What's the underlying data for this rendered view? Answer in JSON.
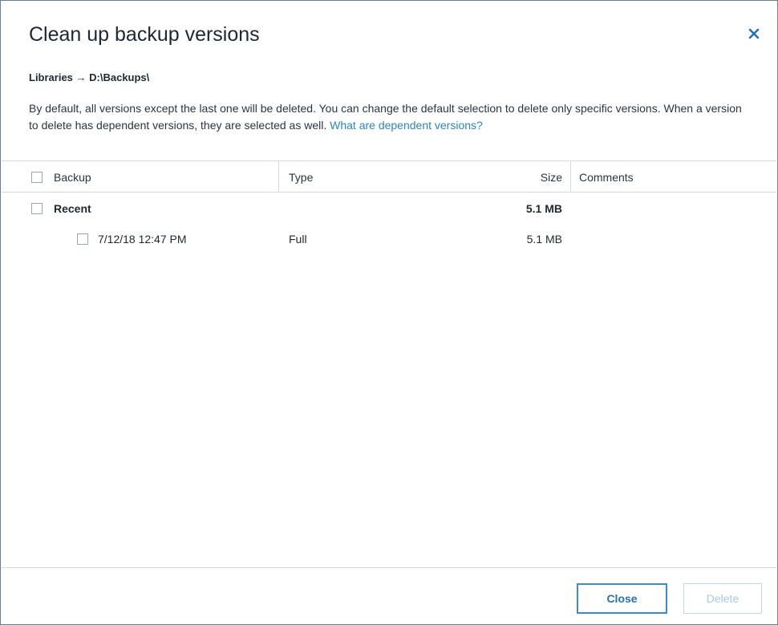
{
  "dialog": {
    "title": "Clean up backup versions",
    "breadcrumb": "Libraries → D:\\Backups\\",
    "description": "By default, all versions except the last one will be deleted. You can change the default selection to delete only specific versions. When a version to delete has dependent versions, they are selected as well.",
    "help_link": "What are dependent versions?",
    "close_icon": "close-icon"
  },
  "table": {
    "columns": {
      "backup": "Backup",
      "type": "Type",
      "size": "Size",
      "comments": "Comments"
    },
    "groups": [
      {
        "name": "Recent",
        "size": "5.1 MB",
        "versions": [
          {
            "date": "7/12/18 12:47 PM",
            "type": "Full",
            "size": "5.1 MB",
            "comments": ""
          }
        ]
      }
    ]
  },
  "buttons": {
    "close": "Close",
    "delete": "Delete"
  },
  "colors": {
    "accent": "#2d84c8",
    "border": "#d4d9df",
    "disabled": "#a8c9e2"
  }
}
